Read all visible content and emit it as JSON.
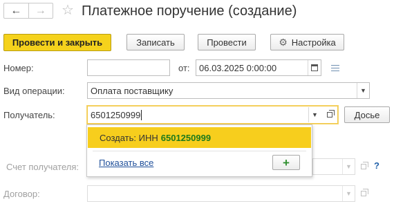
{
  "header": {
    "title": "Платежное поручение (создание)",
    "back_icon": "←",
    "forward_icon": "→",
    "favorite_icon": "☆"
  },
  "toolbar": {
    "post_close_label": "Провести и закрыть",
    "save_label": "Записать",
    "post_label": "Провести",
    "settings_label": "Настройка",
    "settings_icon": "⚙"
  },
  "form": {
    "number_label": "Номер:",
    "number_value": "",
    "date_label": "от:",
    "date_value": "06.03.2025  0:00:00",
    "operation_label": "Вид операции:",
    "operation_value": "Оплата поставщику",
    "recipient_label": "Получатель:",
    "recipient_value": "6501250999",
    "dossier_label": "Досье",
    "account_label": "Счет получателя:",
    "account_help": "?",
    "contract_label": "Договор:"
  },
  "dropdown": {
    "create_prefix": "Создать: ИНН",
    "create_inn": "6501250999",
    "show_all_label": "Показать все",
    "add_label": "+"
  },
  "colors": {
    "primary_button": "#f5d21c",
    "highlight_item": "#f7ce1d",
    "inn_green": "#1d7a1d",
    "link_blue": "#1f4f9a"
  }
}
